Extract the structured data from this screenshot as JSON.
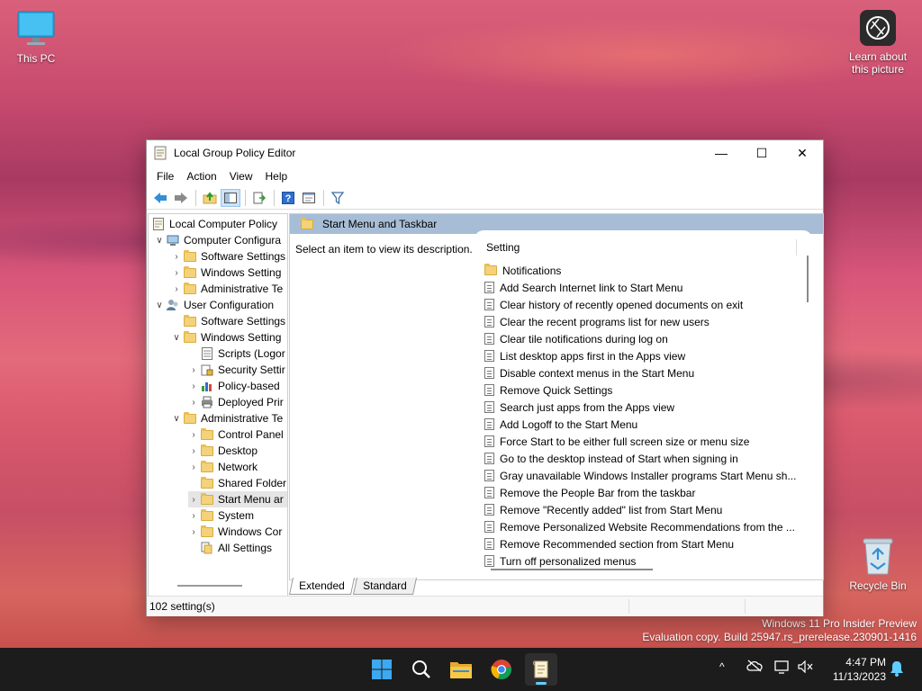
{
  "desktop": {
    "this_pc": "This PC",
    "learn_line1": "Learn about",
    "learn_line2": "this picture",
    "recycle_bin": "Recycle Bin",
    "watermark_line1": "Windows 11 Pro Insider Preview",
    "watermark_line2": "Evaluation copy. Build 25947.rs_prerelease.230901-1416"
  },
  "window": {
    "title": "Local Group Policy Editor",
    "minimize": "—",
    "maximize": "☐",
    "close": "✕"
  },
  "menu": [
    "File",
    "Action",
    "View",
    "Help"
  ],
  "tree": [
    {
      "label": "Local Computer Policy"
    },
    {
      "label": "Computer Configura"
    },
    {
      "label": "Software Settings"
    },
    {
      "label": "Windows Setting"
    },
    {
      "label": "Administrative Te"
    },
    {
      "label": "User Configuration"
    },
    {
      "label": "Software Settings"
    },
    {
      "label": "Windows Setting"
    },
    {
      "label": "Scripts (Logor"
    },
    {
      "label": "Security Settir"
    },
    {
      "label": "Policy-based"
    },
    {
      "label": "Deployed Prir"
    },
    {
      "label": "Administrative Te"
    },
    {
      "label": "Control Panel"
    },
    {
      "label": "Desktop"
    },
    {
      "label": "Network"
    },
    {
      "label": "Shared Folder"
    },
    {
      "label": "Start Menu ar"
    },
    {
      "label": "System"
    },
    {
      "label": "Windows Cor"
    },
    {
      "label": "All Settings"
    }
  ],
  "right_pane": {
    "header": "Start Menu and Taskbar",
    "description": "Select an item to view its description.",
    "column_setting": "Setting",
    "settings": [
      "Notifications",
      "Add Search Internet link to Start Menu",
      "Clear history of recently opened documents on exit",
      "Clear the recent programs list for new users",
      "Clear tile notifications during log on",
      "List desktop apps first in the Apps view",
      "Disable context menus in the Start Menu",
      "Remove Quick Settings",
      "Search just apps from the Apps view",
      "Add Logoff to the Start Menu",
      "Force Start to be either full screen size or menu size",
      "Go to the desktop instead of Start when signing in",
      "Gray unavailable Windows Installer programs Start Menu sh...",
      "Remove the People Bar from the taskbar",
      "Remove \"Recently added\" list from Start Menu",
      "Remove Personalized Website Recommendations from the ...",
      "Remove Recommended section from Start Menu",
      "Turn off personalized menus"
    ]
  },
  "tabs": {
    "extended": "Extended",
    "standard": "Standard"
  },
  "status": {
    "count": "102 setting(s)"
  },
  "taskbar": {
    "time": "4:47 PM",
    "date": "11/13/2023",
    "chevron": "^",
    "icons": [
      "windows-start-icon",
      "search-icon",
      "file-explorer-icon",
      "chrome-icon",
      "group-policy-editor-icon"
    ]
  }
}
